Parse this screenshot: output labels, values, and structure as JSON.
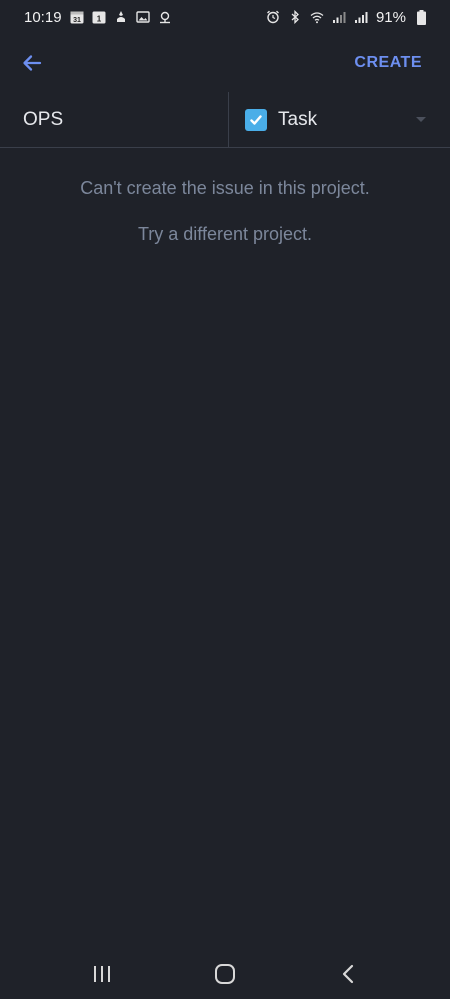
{
  "status_bar": {
    "time": "10:19",
    "calendar_day": "31",
    "badge_day": "1",
    "battery": "91%",
    "left_icons": [
      "calendar-icon",
      "calendar-badge-icon",
      "gesture-icon",
      "gallery-icon",
      "location-icon"
    ],
    "right_icons": [
      "alarm-icon",
      "bluetooth-icon",
      "wifi-icon",
      "signal-icon",
      "signal-icon",
      "battery-icon"
    ]
  },
  "app_bar": {
    "back_icon": "arrow-left-icon",
    "create_label": "CREATE",
    "accent_color": "#6d8ff0"
  },
  "selector": {
    "project": "OPS",
    "issue_type": "Task",
    "issue_type_icon": "checkbox-checked-icon",
    "issue_type_color": "#4aaee8"
  },
  "messages": {
    "error": "Can't create the issue in this project.",
    "hint": "Try a different project."
  },
  "nav_bar": {
    "recent_icon": "recent-apps-icon",
    "home_icon": "home-icon",
    "back_icon": "back-icon"
  }
}
